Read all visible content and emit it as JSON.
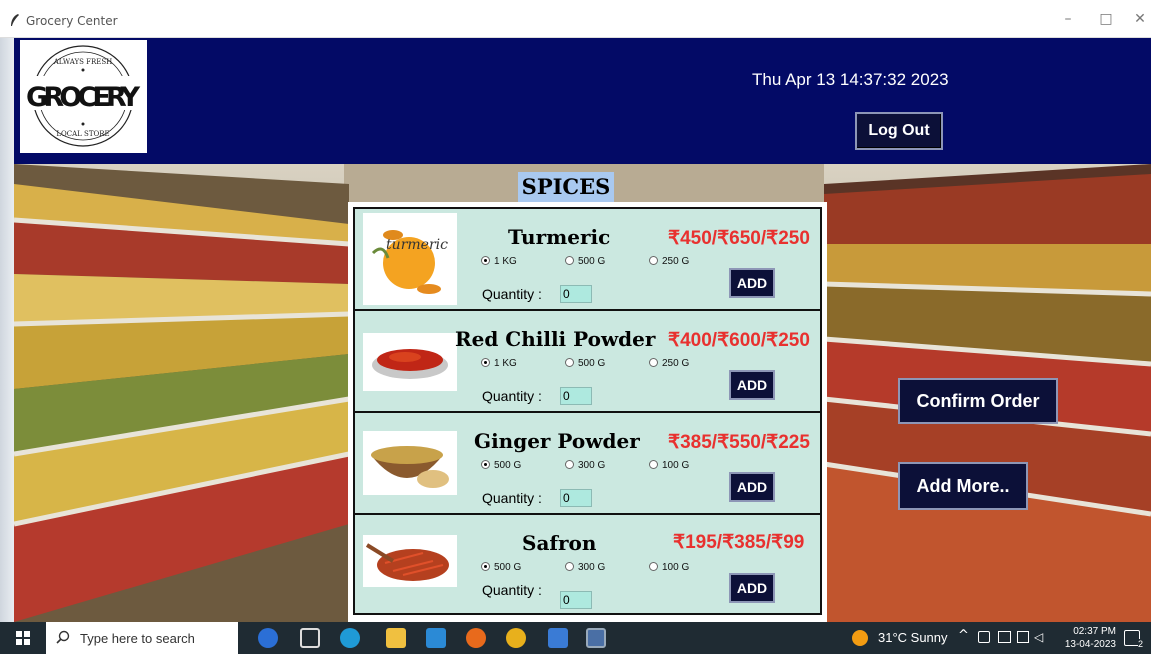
{
  "window": {
    "title": "Grocery Center",
    "minimize": "–",
    "maximize": "□",
    "close": "✕"
  },
  "header": {
    "logo": {
      "top_text": "ALWAYS FRESH",
      "main_text": "GROCERY",
      "bottom_text": "LOCAL STORE"
    },
    "datetime": "Thu Apr 13 14:37:32 2023",
    "logout_label": "Log Out"
  },
  "section_title": "SPICES",
  "products": [
    {
      "name": "Turmeric",
      "price": "₹450/₹650/₹250",
      "image_label": "turmeric",
      "options": [
        "1 KG",
        "500 G",
        "250 G"
      ],
      "selected": 0,
      "quantity_label": "Quantity :",
      "quantity": "0",
      "add_label": "ADD"
    },
    {
      "name": "Red Chilli Powder",
      "price": "₹400/₹600/₹250",
      "image_label": "",
      "options": [
        "1 KG",
        "500 G",
        "250 G"
      ],
      "selected": 0,
      "quantity_label": "Quantity :",
      "quantity": "0",
      "add_label": "ADD"
    },
    {
      "name": "Ginger Powder",
      "price": "₹385/₹550/₹225",
      "image_label": "",
      "options": [
        "500 G",
        "300 G",
        "100 G"
      ],
      "selected": 0,
      "quantity_label": "Quantity :",
      "quantity": "0",
      "add_label": "ADD"
    },
    {
      "name": "Safron",
      "price": "₹195/₹385/₹99",
      "image_label": "",
      "options": [
        "500 G",
        "300 G",
        "100 G"
      ],
      "selected": 0,
      "quantity_label": "Quantity :",
      "quantity": "0",
      "add_label": "ADD"
    }
  ],
  "actions": {
    "confirm_label": "Confirm Order",
    "add_more_label": "Add More.."
  },
  "taskbar": {
    "search_placeholder": "Type here to search",
    "weather": "31°C  Sunny",
    "time": "02:37 PM",
    "date": "13-04-2023",
    "notification_count": "2"
  },
  "colors": {
    "header_bg": "#030a66",
    "panel_bg": "#cbe8e0",
    "price": "#e8312f",
    "button_bg": "#0c1038",
    "title_badge": "#a9c9f0"
  }
}
